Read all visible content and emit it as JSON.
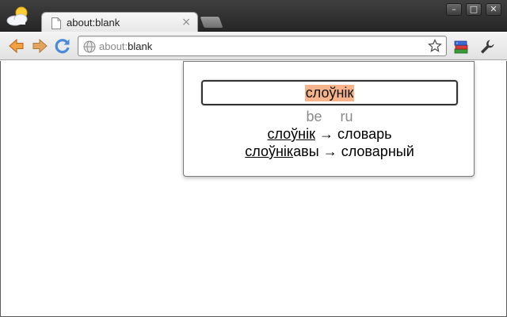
{
  "tab": {
    "title": "about:blank",
    "close_glyph": "×"
  },
  "window_controls": {
    "minimize": "–",
    "maximize": "□",
    "close": "✕"
  },
  "omnibox": {
    "url_scheme": "about:",
    "url_host": "blank"
  },
  "icons": {
    "app": "weather-cloud-sun-icon",
    "tab_favicon": "page-icon",
    "back": "back-arrow-icon",
    "forward": "forward-arrow-icon",
    "reload": "reload-icon",
    "site": "globe-icon",
    "bookmark": "star-icon",
    "extension": "books-icon",
    "menu": "wrench-icon"
  },
  "popup": {
    "input_value": "слоўнік",
    "lang_from": "be",
    "lang_to": "ru",
    "results": [
      {
        "match": "слоўнік",
        "rest": "",
        "arrow": "→",
        "translation": "словарь"
      },
      {
        "match": "слоўнік",
        "rest": "авы",
        "arrow": "→",
        "translation": "словарный"
      }
    ]
  },
  "colors": {
    "highlight": "#f7b48a",
    "tabstrip": "#2f2f2f",
    "toolbar": "#e8e8e8"
  }
}
